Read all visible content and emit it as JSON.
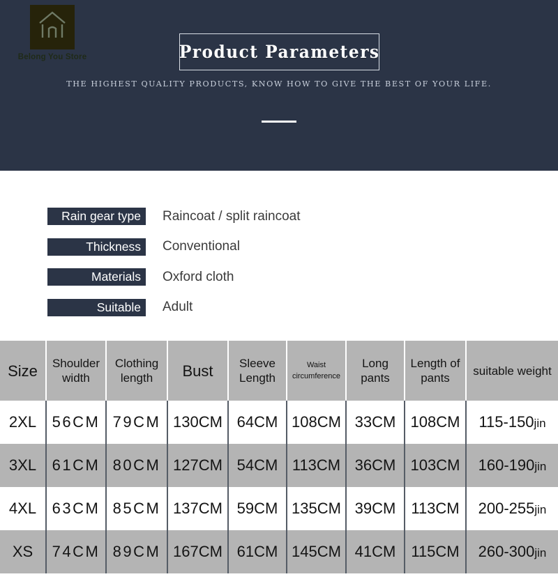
{
  "hero": {
    "logo_name": "Belong You Store",
    "logo_icon": "house-icon",
    "title": "Product Parameters",
    "subtitle": "THE HIGHEST QUALITY PRODUCTS, KNOW HOW TO GIVE THE BEST OF YOUR LIFE.",
    "background_color": "#2b3446",
    "title_color": "#ffffff",
    "subtitle_color": "#c8cfdb"
  },
  "specs": [
    {
      "label": "Rain gear type",
      "value": "Raincoat / split raincoat"
    },
    {
      "label": "Thickness",
      "value": "Conventional"
    },
    {
      "label": "Materials",
      "value": "Oxford cloth"
    },
    {
      "label": "Suitable",
      "value": "Adult"
    }
  ],
  "spec_style": {
    "badge_color": "#2b3446",
    "badge_text_color": "#ffffff",
    "value_color": "#3b3b3b"
  },
  "size_table": {
    "headers": [
      "Size",
      "Shoulder width",
      "Clothing length",
      "Bust",
      "Sleeve Length",
      "Waist circumference",
      "Long pants",
      "Length of pants",
      "suitable weight"
    ],
    "rows": [
      {
        "size": "2XL",
        "shoulder_width": "56CM",
        "clothing_length": "79CM",
        "bust": "130CM",
        "sleeve_length": "64CM",
        "waist_circumference": "108CM",
        "long_pants": "33CM",
        "length_of_pants": "108CM",
        "weight_range": "115-150",
        "weight_unit": "jin"
      },
      {
        "size": "3XL",
        "shoulder_width": "61CM",
        "clothing_length": "80CM",
        "bust": "127CM",
        "sleeve_length": "54CM",
        "waist_circumference": "113CM",
        "long_pants": "36CM",
        "length_of_pants": "103CM",
        "weight_range": "160-190",
        "weight_unit": "jin"
      },
      {
        "size": "4XL",
        "shoulder_width": "63CM",
        "clothing_length": "85CM",
        "bust": "137CM",
        "sleeve_length": "59CM",
        "waist_circumference": "135CM",
        "long_pants": "39CM",
        "length_of_pants": "113CM",
        "weight_range": "200-255",
        "weight_unit": "jin"
      },
      {
        "size": "XS",
        "shoulder_width": "74CM",
        "clothing_length": "89CM",
        "bust": "167CM",
        "sleeve_length": "61CM",
        "waist_circumference": "145CM",
        "long_pants": "41CM",
        "length_of_pants": "115CM",
        "weight_range": "260-300",
        "weight_unit": "jin"
      }
    ],
    "header_bg": "#b4b4b4",
    "alt_row_bg": "#b4b4b4",
    "row_bg": "#ffffff"
  }
}
